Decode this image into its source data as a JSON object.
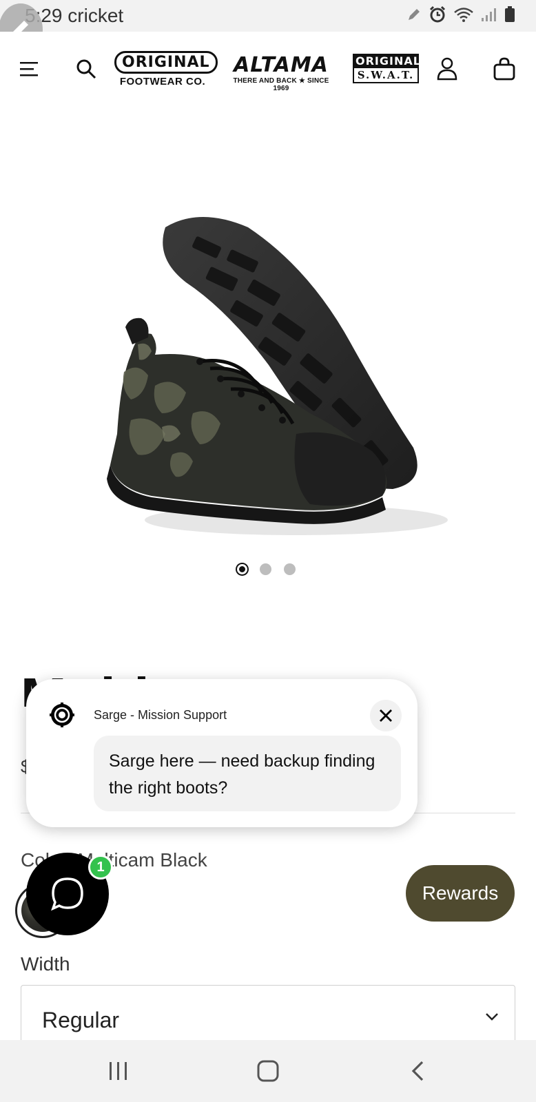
{
  "status_bar": {
    "time": "5:29",
    "carrier": "cricket",
    "icons": [
      "pencil-icon",
      "alarm-icon",
      "wifi-icon",
      "signal-icon",
      "battery-icon"
    ]
  },
  "header": {
    "logos": {
      "original_footwear": {
        "top": "ORIGINAL",
        "sub": "FOOTWEAR CO."
      },
      "altama": {
        "top": "ALTAMA",
        "sub": "THERE AND BACK ★ SINCE 1969"
      },
      "original_swat": {
        "top": "ORIGINAL",
        "sub": "S.W.A.T."
      }
    },
    "icons": [
      "menu-icon",
      "search-icon",
      "account-icon",
      "cart-icon"
    ]
  },
  "gallery": {
    "slide_count": 3,
    "active_index": 0
  },
  "product": {
    "title_fragment": "Multicam",
    "price_fragment": "$",
    "color_label": "Color:",
    "color_value": "Multicam Black",
    "width_label": "Width",
    "width_value": "Regular"
  },
  "chat_popup": {
    "agent_name": "Sarge - Mission Support",
    "message": "Sarge here — need backup finding the right boots?"
  },
  "chat_launcher": {
    "badge_count": "1"
  },
  "rewards": {
    "label": "Rewards",
    "color": "#4f4a2f"
  },
  "colors": {
    "accent_green": "#33c24d",
    "rewards_olive": "#4f4a2f"
  }
}
